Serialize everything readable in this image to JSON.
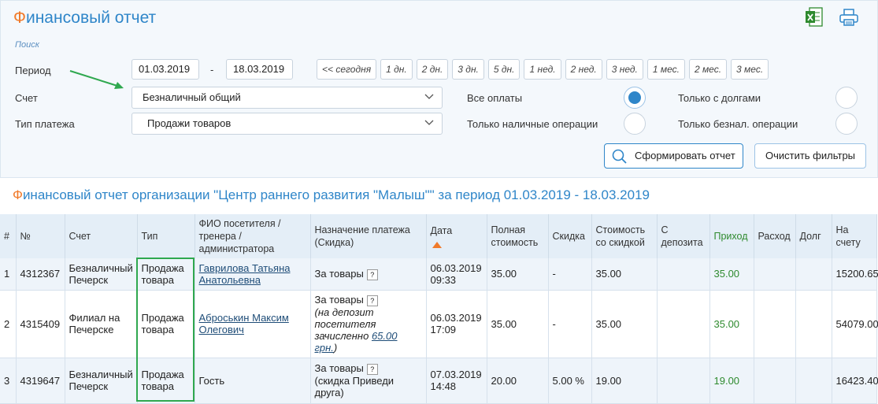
{
  "header": {
    "title_first": "Ф",
    "title_rest": "инансовый отчет",
    "icons": [
      "excel-icon",
      "printer-icon"
    ]
  },
  "filters": {
    "search_label": "Поиск",
    "period_label": "Период",
    "date_from": "01.03.2019",
    "date_to": "18.03.2019",
    "dash": "-",
    "quick_periods": [
      "<< сегодня",
      "1 дн.",
      "2 дн.",
      "3 дн.",
      "5 дн.",
      "1 нед.",
      "2 нед.",
      "3 нед.",
      "1 мес.",
      "2 мес.",
      "3 мес."
    ],
    "account_label": "Счет",
    "account_value": "Безналичный общий",
    "payment_type_label": "Тип платежа",
    "payment_type_value": "Продажи товаров",
    "radios": {
      "all_payments": "Все оплаты",
      "only_debts": "Только с долгами",
      "only_cash": "Только наличные операции",
      "only_noncash": "Только безнал. операции"
    },
    "generate_button": "Сформировать отчет",
    "clear_button": "Очистить фильтры"
  },
  "report": {
    "title_first": "Ф",
    "title_rest": "инансовый отчет организации \"Центр раннего развития \"Малыш\"\" за период 01.03.2019 - 18.03.2019",
    "columns": [
      "#",
      "№",
      "Счет",
      "Тип",
      "ФИО посетителя / тренера / администратора",
      "Назначение платежа (Скидка)",
      "Дата",
      "Полная стоимость",
      "Скидка",
      "Стоимость со скидкой",
      "С депозита",
      "Приход",
      "Расход",
      "Долг",
      "На счету"
    ],
    "rows": [
      {
        "idx": "1",
        "num": "4312367",
        "account": "Безналичный Печерск",
        "type": "Продажа товара",
        "person": "Гаврилова Татьяна Анатольевна",
        "purpose": "За товары",
        "purpose_q": "?",
        "purpose_note": "",
        "purpose_note_link": "",
        "purpose_note_end": "",
        "date": "06.03.2019",
        "time": "09:33",
        "full": "35.00",
        "discount": "-",
        "discounted": "35.00",
        "deposit": "",
        "income": "35.00",
        "expense": "",
        "debt": "",
        "balance": "15200.65"
      },
      {
        "idx": "2",
        "num": "4315409",
        "account": "Филиал на Печерске",
        "type": "Продажа товара",
        "person": "Аброськин Максим Олегович",
        "purpose": "За товары",
        "purpose_q": "?",
        "purpose_note": "(на депозит посетителя зачисленно",
        "purpose_note_link": "65.00 грн.",
        "purpose_note_end": ")",
        "date": "06.03.2019",
        "time": "17:09",
        "full": "35.00",
        "discount": "-",
        "discounted": "35.00",
        "deposit": "",
        "income": "35.00",
        "expense": "",
        "debt": "",
        "balance": "54079.00"
      },
      {
        "idx": "3",
        "num": "4319647",
        "account": "Безналичный Печерск",
        "type": "Продажа товара",
        "person": "Гость",
        "purpose": "За товары",
        "purpose_q": "?",
        "purpose_note": "(скидка Приведи друга)",
        "purpose_note_link": "",
        "purpose_note_end": "",
        "date": "07.03.2019",
        "time": "14:48",
        "full": "20.00",
        "discount": "5.00 %",
        "discounted": "19.00",
        "deposit": "",
        "income": "19.00",
        "expense": "",
        "debt": "",
        "balance": "16423.40"
      }
    ]
  },
  "colors": {
    "accent": "#2f86c9",
    "title_first_letter": "#f07a2a",
    "income": "#2e8a2e",
    "highlight_box": "#2fa84f",
    "arrow": "#2fa84f"
  }
}
